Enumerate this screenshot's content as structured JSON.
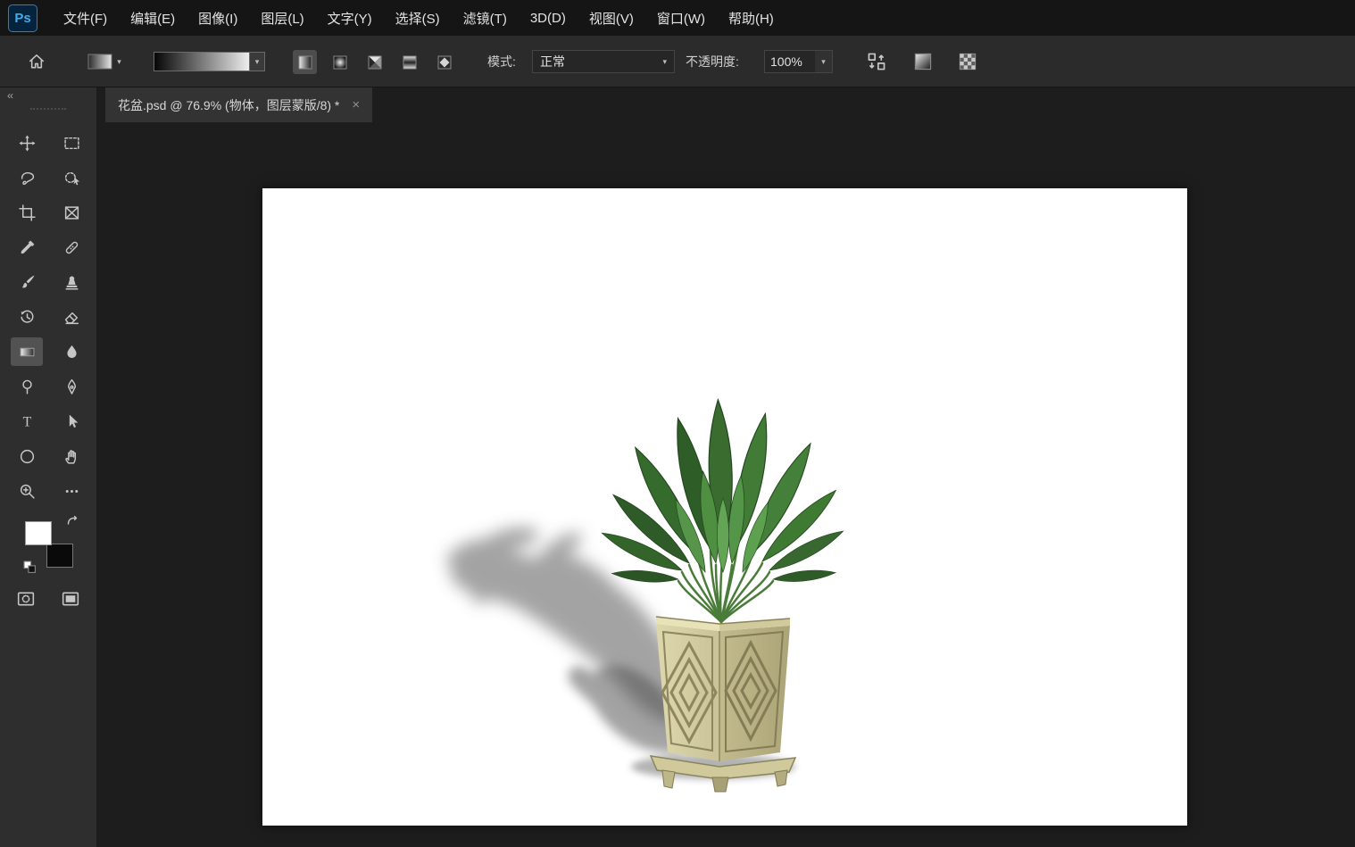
{
  "app": {
    "logo_text": "Ps"
  },
  "menu_bar": {
    "items": [
      "文件(F)",
      "编辑(E)",
      "图像(I)",
      "图层(L)",
      "文字(Y)",
      "选择(S)",
      "滤镜(T)",
      "3D(D)",
      "视图(V)",
      "窗口(W)",
      "帮助(H)"
    ]
  },
  "options_bar": {
    "mode_label": "模式:",
    "mode_value": "正常",
    "opacity_label": "不透明度:",
    "opacity_value": "100%",
    "chevron_glyph": "▾"
  },
  "document": {
    "tab_title": "花盆.psd @ 76.9% (物体，图层蒙版/8) *",
    "close_glyph": "×",
    "zoom_percent": "76.9%"
  },
  "toolbar": {
    "collapse_glyph": "‹‹",
    "selected_tool": "gradient",
    "tools": [
      "move",
      "rectangular-marquee",
      "lasso",
      "object-selection",
      "crop",
      "frame",
      "eyedropper",
      "spot-healing-brush",
      "brush",
      "clone-stamp",
      "history-brush",
      "eraser",
      "gradient",
      "blur",
      "dodge",
      "pen",
      "type",
      "path-selection",
      "ellipse-shape",
      "hand",
      "zoom",
      "more-tools"
    ],
    "type_tool_glyph": "T"
  },
  "colors": {
    "foreground": "#ffffff",
    "background": "#000000",
    "logo_blue": "#46a9e8",
    "panel_gray": "#2e2e2e",
    "canvas_white": "#ffffff"
  }
}
